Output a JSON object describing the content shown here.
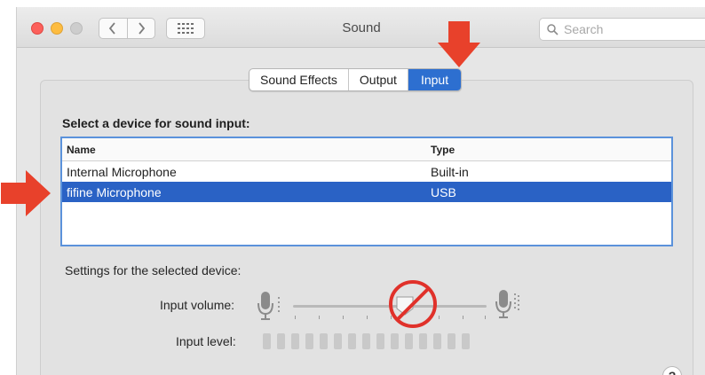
{
  "window": {
    "title": "Sound"
  },
  "search": {
    "placeholder": "Search"
  },
  "tabs": [
    {
      "label": "Sound Effects",
      "active": false
    },
    {
      "label": "Output",
      "active": false
    },
    {
      "label": "Input",
      "active": true
    }
  ],
  "input_pane": {
    "heading": "Select a device for sound input:",
    "columns": [
      "Name",
      "Type"
    ],
    "devices": [
      {
        "name": "Internal Microphone",
        "type": "Built-in",
        "selected": false
      },
      {
        "name": "fifine Microphone",
        "type": "USB",
        "selected": true
      }
    ],
    "settings_label": "Settings for the selected device:",
    "input_volume_label": "Input volume:",
    "input_volume_fraction": 0.58,
    "input_level_label": "Input level:",
    "input_level_segments_lit": 0,
    "input_level_segments_total": 15
  },
  "help": {
    "label": "?"
  },
  "colors": {
    "accent": "#2d6fd0",
    "selection": "#2a62c5",
    "annotation_arrow": "#e8412b",
    "no_sign": "#e0312a"
  },
  "icons": {
    "back": "chevron-left-icon",
    "forward": "chevron-right-icon",
    "grid": "grid-icon",
    "search": "search-icon",
    "mic_low": "microphone-low-icon",
    "mic_high": "microphone-high-icon",
    "no_sign": "prohibited-icon"
  }
}
